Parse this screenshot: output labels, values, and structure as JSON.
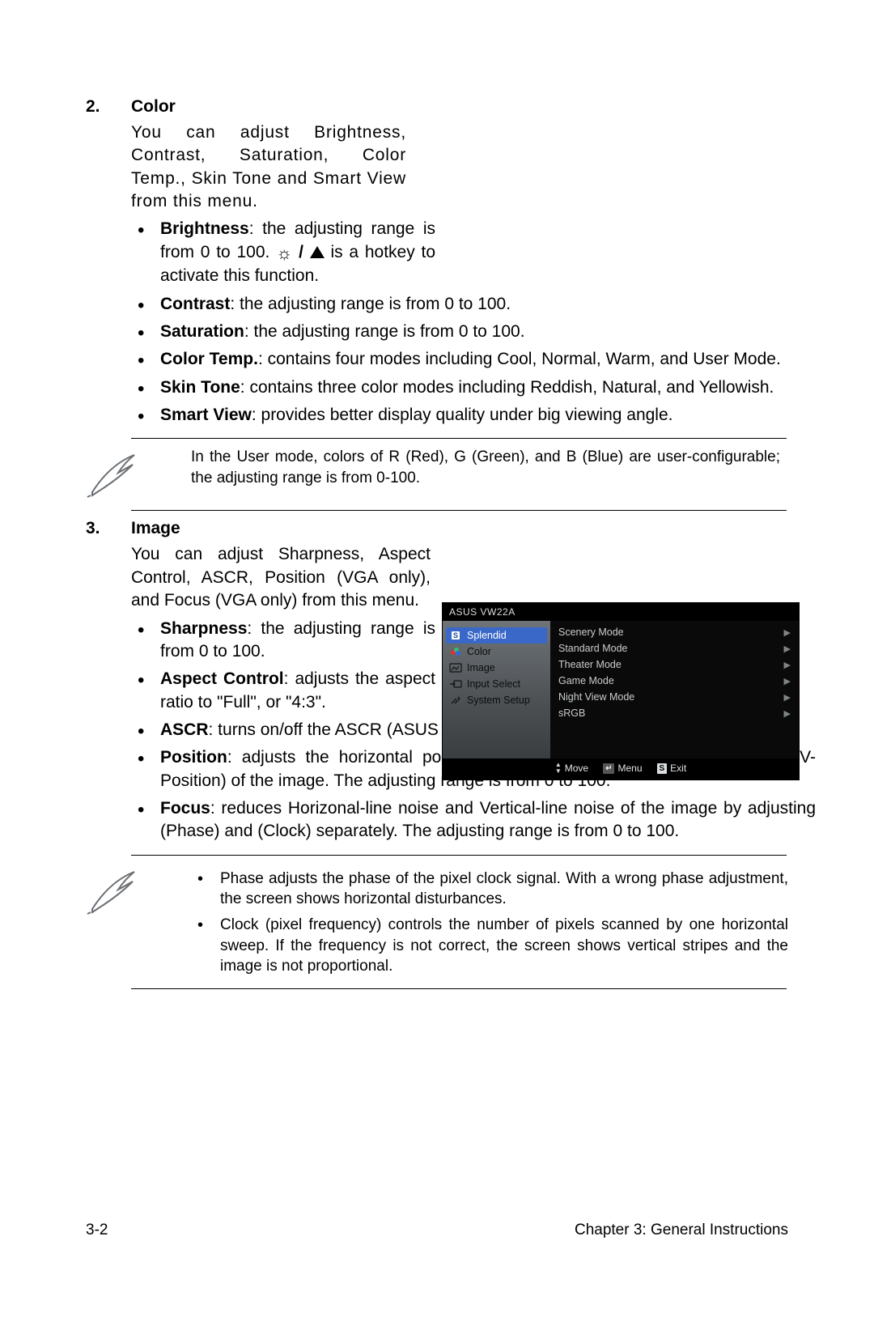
{
  "sections": {
    "color": {
      "num": "2.",
      "title": "Color",
      "intro": "You can adjust Brightness, Contrast, Saturation, Color Temp., Skin Tone and Smart View from this menu.",
      "bullets": {
        "b0_label": "Brightness",
        "b0_a": ": the adjusting range is from 0 to 100. ",
        "b0_b": " is a hotkey to activate this function.",
        "b1_label": "Contrast",
        "b1_text": ": the adjusting range is from 0 to 100.",
        "b2_label": "Saturation",
        "b2_text": ": the adjusting range is from 0 to 100.",
        "b3_label": "Color Temp.",
        "b3_text": ": contains four modes including Cool, Normal, Warm, and User Mode.",
        "b4_label": "Skin Tone",
        "b4_text": ": contains three color modes including Reddish, Natural, and Yellowish.",
        "b5_label": "Smart View",
        "b5_text": ": provides better display quality under big viewing angle."
      },
      "note": "In the User mode, colors of R (Red), G (Green), and B (Blue) are user-configurable; the adjusting range is from 0-100."
    },
    "image": {
      "num": "3.",
      "title": "Image",
      "intro": "You can adjust Sharpness, Aspect Control, ASCR, Position (VGA only), and Focus (VGA only) from this menu.",
      "bullets": {
        "b0_label": "Sharpness",
        "b0_text": ": the adjusting range is from 0 to 100.",
        "b1_label": "Aspect Control",
        "b1_text": ": adjusts the aspect ratio to \"Full\", or \"4:3\".",
        "b2_label": "ASCR",
        "b2_text": ": turns on/off the ASCR (ASUS Smart Contrast Ratio) function.",
        "b3_label": "Position",
        "b3_text": ": adjusts the horizontal position (H-Position) and the vertical position (V-Position) of the image. The adjusting range is from 0 to 100.",
        "b4_label": "Focus",
        "b4_text": ": reduces Horizonal-line noise and Vertical-line noise of the image by adjusting (Phase) and (Clock) separately. The adjusting range is from 0 to 100."
      },
      "notes": {
        "n0": "Phase adjusts the phase of the pixel clock signal. With a wrong phase adjustment, the screen shows horizontal disturbances.",
        "n1": "Clock (pixel frequency) controls the number of pixels scanned by one horizontal sweep. If the frequency is not correct, the screen shows vertical stripes and the image is not proportional."
      }
    }
  },
  "osd": {
    "title": "ASUS VW22A",
    "side": {
      "i0": "Splendid",
      "i1": "Color",
      "i2": "Image",
      "i3": "Input Select",
      "i4": "System Setup"
    },
    "main": {
      "m0": "Scenery Mode",
      "m1": "Standard Mode",
      "m2": "Theater Mode",
      "m3": "Game Mode",
      "m4": "Night View Mode",
      "m5": "sRGB"
    },
    "foot": {
      "move": "Move",
      "menu": "Menu",
      "exit": "Exit",
      "menukey": "↵",
      "exitkey": "S"
    }
  },
  "footer": {
    "left": "3-2",
    "right": "Chapter 3: General Instructions"
  }
}
